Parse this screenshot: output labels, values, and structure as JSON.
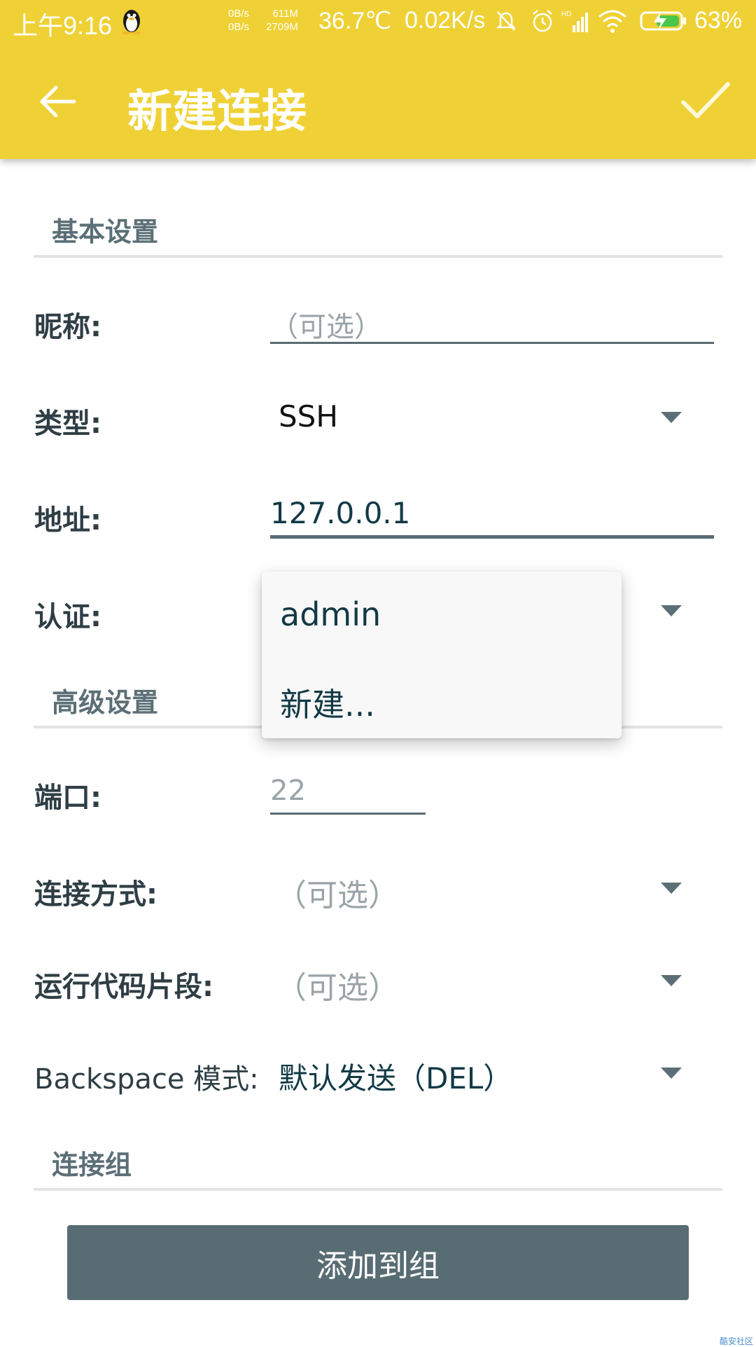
{
  "status_bar": {
    "time": "上午9:16",
    "net_up": "0B/s",
    "net_down": "0B/s",
    "mem_used": "611M",
    "mem_total": "2709M",
    "temperature": "36.7℃",
    "speed": "0.02K/s",
    "battery": "63%",
    "icons": [
      "qq-penguin-icon",
      "mute-icon",
      "alarm-icon",
      "hd-signal-icon",
      "wifi-icon",
      "battery-charging-icon"
    ]
  },
  "app_bar": {
    "title": "新建连接",
    "back_icon": "arrow-left-icon",
    "confirm_icon": "check-icon",
    "color": "#efd135"
  },
  "basic_section": {
    "label": "基本设置"
  },
  "fields": {
    "nickname": {
      "label": "昵称:",
      "placeholder": "（可选）"
    },
    "type": {
      "label": "类型:",
      "value": "SSH"
    },
    "address": {
      "label": "地址:",
      "value": "127.0.0.1"
    },
    "auth": {
      "label": "认证:"
    }
  },
  "auth_dropdown": {
    "options": [
      "admin",
      "新建..."
    ]
  },
  "advanced_section": {
    "label": "高级设置",
    "port": {
      "label": "端口:",
      "placeholder": "22"
    },
    "connect_mode": {
      "label": "连接方式:",
      "placeholder": "（可选）"
    },
    "snippet": {
      "label": "运行代码片段:",
      "placeholder": "（可选）"
    },
    "backspace": {
      "label": "Backspace 模式:",
      "value": "默认发送（DEL）"
    }
  },
  "group_section": {
    "label": "连接组",
    "button_label": "添加到组"
  },
  "watermark": "酷安社区"
}
